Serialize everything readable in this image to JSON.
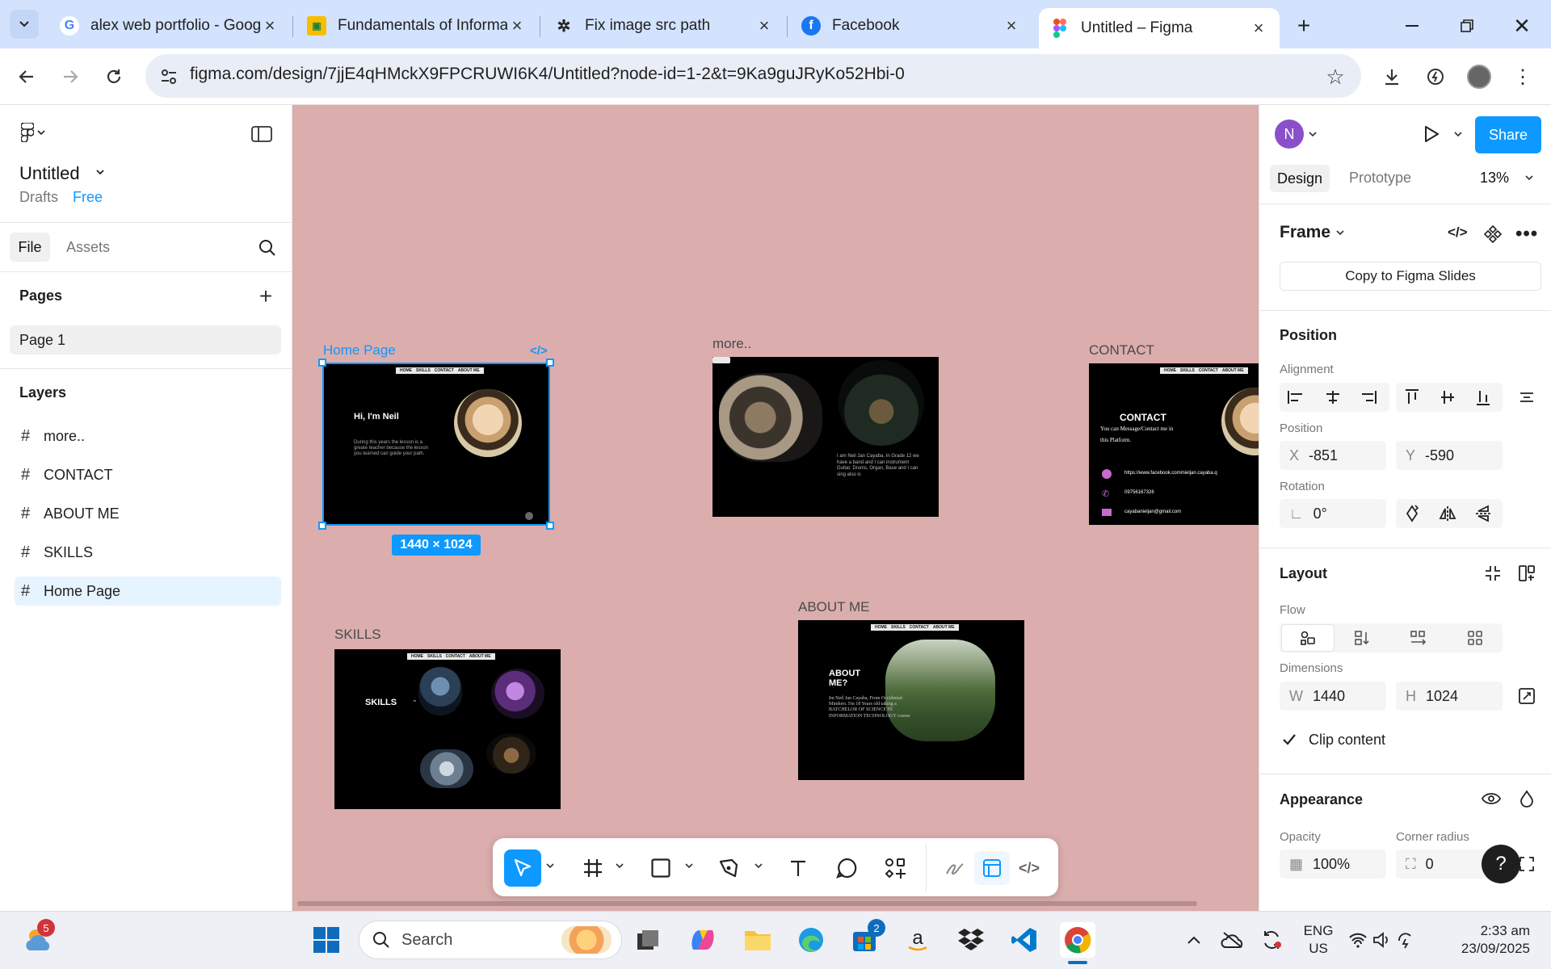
{
  "browser": {
    "tabs": [
      {
        "title": "alex web portfolio - Goog",
        "icon": "google-icon"
      },
      {
        "title": "Fundamentals of Informa",
        "icon": "classroom-icon"
      },
      {
        "title": "Fix image src path",
        "icon": "chatgpt-icon"
      },
      {
        "title": "Facebook",
        "icon": "facebook-icon"
      },
      {
        "title": "Untitled – Figma",
        "icon": "figma-icon",
        "active": true
      }
    ],
    "url": "figma.com/design/7jjE4qHMckX9FPCRUWI6K4/Untitled?node-id=1-2&t=9Ka9guJRyKo52Hbi-0"
  },
  "left_panel": {
    "file_title": "Untitled",
    "location": "Drafts",
    "plan": "Free",
    "tabs": [
      "File",
      "Assets"
    ],
    "pages_heading": "Pages",
    "pages": [
      "Page 1"
    ],
    "layers_heading": "Layers",
    "layers": [
      {
        "name": "more..",
        "selected": false
      },
      {
        "name": "CONTACT",
        "selected": false
      },
      {
        "name": "ABOUT ME",
        "selected": false
      },
      {
        "name": "SKILLS",
        "selected": false
      },
      {
        "name": "Home Page",
        "selected": true
      }
    ]
  },
  "canvas": {
    "background": "#dbadad",
    "selection_color": "#0d99ff",
    "selected_size": "1440 × 1024",
    "frames": {
      "home": {
        "label": "Home Page",
        "nav": [
          "HOME",
          "SKILLS",
          "CONTACT",
          "ABOUT ME"
        ],
        "heading": "Hi, I'm Neil",
        "body": "During this years the lesson is a greate teacher because the lesson you learned can guide your path."
      },
      "more": {
        "label": "more..",
        "body": "I am Neil Jan Cayaba, In Grade 12 we have a band and I can instrument Guitar, Drums, Organ, Base and I can sing also is"
      },
      "contact": {
        "label": "CONTACT",
        "nav": [
          "HOME",
          "SKILLS",
          "CONTACT",
          "ABOUT ME"
        ],
        "heading": "CONTACT",
        "sub": "You can Message/Contact me in this Platform.",
        "facebook": "https://www.facebook.com/nieljan.cayaba.q",
        "phone": "09756167326",
        "email": "cayabanieljan@gmail.com"
      },
      "skills": {
        "label": "SKILLS",
        "nav": [
          "HOME",
          "SKILLS",
          "CONTACT",
          "ABOUT ME"
        ],
        "heading": "SKILLS"
      },
      "about": {
        "label": "ABOUT ME",
        "nav": [
          "HOME",
          "SKILLS",
          "CONTACT",
          "ABOUT ME"
        ],
        "heading": "ABOUT ME?",
        "body": "Im Neil Jan Cayaba, From Occidental Mindoro. I'm 18 Years old taking a BATCHELOR OF SCIENCE IN INFORMATION TECHNOLOGY course"
      }
    }
  },
  "right_panel": {
    "avatar_letter": "N",
    "share_label": "Share",
    "tabs": [
      "Design",
      "Prototype"
    ],
    "zoom": "13%",
    "frame_type": "Frame",
    "copy_slides_label": "Copy to Figma Slides",
    "position_heading": "Position",
    "alignment_label": "Alignment",
    "position_label": "Position",
    "x_label": "X",
    "x_value": "-851",
    "y_label": "Y",
    "y_value": "-590",
    "rotation_label": "Rotation",
    "rotation_value": "0°",
    "layout_heading": "Layout",
    "flow_label": "Flow",
    "dimensions_label": "Dimensions",
    "w_label": "W",
    "w_value": "1440",
    "h_label": "H",
    "h_value": "1024",
    "clip_content_label": "Clip content",
    "clip_content_checked": true,
    "appearance_heading": "Appearance",
    "opacity_label": "Opacity",
    "opacity_value": "100%",
    "corner_radius_label": "Corner radius",
    "corner_radius_value": "0",
    "help_label": "?"
  },
  "taskbar": {
    "weather_badge": "5",
    "search_placeholder": "Search",
    "store_badge": "2",
    "language": "ENG",
    "region": "US",
    "time": "2:33 am",
    "date": "23/09/2025"
  },
  "colors": {
    "accent": "#0d99ff",
    "tabbar": "#d3e3fd",
    "avatar": "#8a4fc9"
  }
}
